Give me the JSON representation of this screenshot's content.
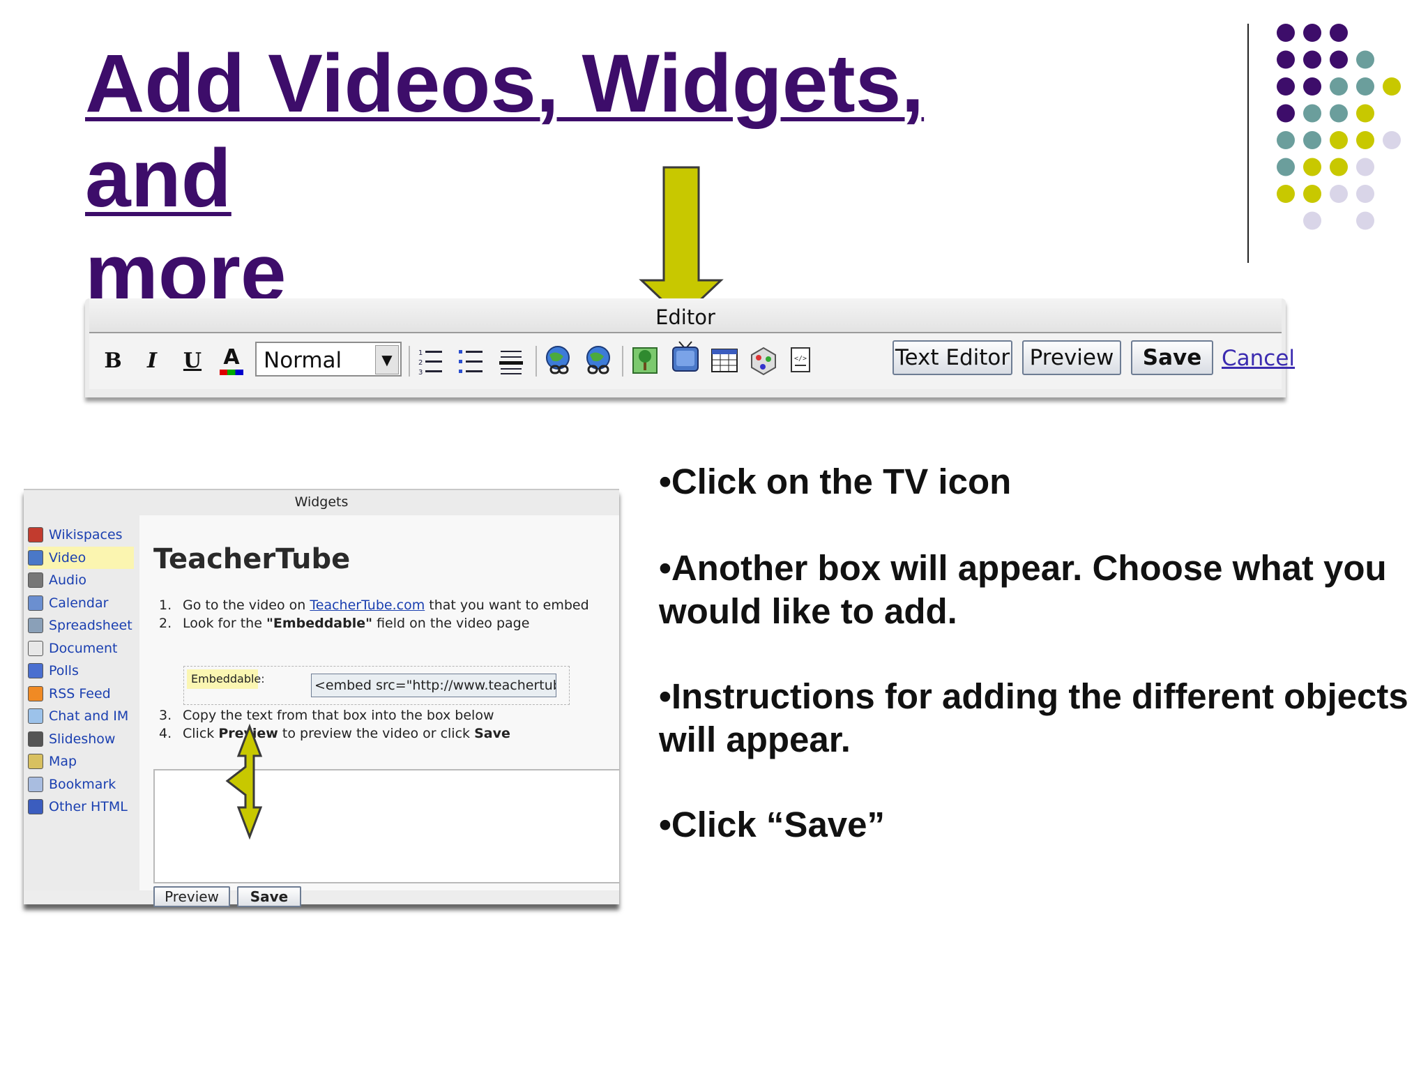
{
  "slide": {
    "title_line1": "Add Videos, Widgets, and",
    "title_line2": "more"
  },
  "colors": {
    "title": "#3d0d6a",
    "accent_yellow": "#c8c800",
    "dot_purple": "#3d0d6a",
    "dot_teal": "#6b9e9c",
    "dot_yellow": "#c8c800",
    "dot_lavender": "#d9d5e8"
  },
  "editor": {
    "title": "Editor",
    "bold_label": "B",
    "italic_label": "I",
    "underline_label": "U",
    "text_color_label": "A",
    "style_value": "Normal",
    "text_editor_button": "Text Editor",
    "preview_button": "Preview",
    "save_button": "Save",
    "cancel_link": "Cancel",
    "icons": [
      "numbered-list-icon",
      "bullet-list-icon",
      "horizontal-rule-icon",
      "link-icon",
      "external-link-icon",
      "image-icon",
      "tv-icon",
      "table-icon",
      "special-char-icon",
      "page-icon"
    ]
  },
  "widgets": {
    "title": "Widgets",
    "items": [
      {
        "label": "Wikispaces",
        "icon": "wikispaces-icon",
        "selected": false
      },
      {
        "label": "Video",
        "icon": "tv-icon",
        "selected": true
      },
      {
        "label": "Audio",
        "icon": "speaker-icon",
        "selected": false
      },
      {
        "label": "Calendar",
        "icon": "calendar-icon",
        "selected": false
      },
      {
        "label": "Spreadsheet",
        "icon": "spreadsheet-icon",
        "selected": false
      },
      {
        "label": "Document",
        "icon": "document-icon",
        "selected": false
      },
      {
        "label": "Polls",
        "icon": "poll-chart-icon",
        "selected": false
      },
      {
        "label": "RSS Feed",
        "icon": "rss-icon",
        "selected": false
      },
      {
        "label": "Chat and IM",
        "icon": "chat-icon",
        "selected": false
      },
      {
        "label": "Slideshow",
        "icon": "camera-icon",
        "selected": false
      },
      {
        "label": "Map",
        "icon": "map-icon",
        "selected": false
      },
      {
        "label": "Bookmark",
        "icon": "bookmark-tag-icon",
        "selected": false
      },
      {
        "label": "Other HTML",
        "icon": "html-icon",
        "selected": false
      }
    ],
    "main_title": "TeacherTube",
    "step1_num": "1.",
    "step1_pre": "Go to the video on ",
    "step1_link": "TeacherTube.com",
    "step1_post": " that you want to embed",
    "step2_num": "2.",
    "step2_pre": "Look for the ",
    "step2_bold": "\"Embeddable\"",
    "step2_post": " field on the video page",
    "embed_label": "Embeddable:",
    "embed_value": "<embed src=\"http://www.teachertube",
    "step3_num": "3.",
    "step3_text": "Copy the text from that box into the box below",
    "step4_num": "4.",
    "step4_pre": "Click ",
    "step4_bold1": "Preview",
    "step4_mid": " to preview the video or click ",
    "step4_bold2": "Save",
    "preview_button": "Preview",
    "save_button": "Save"
  },
  "bullets": {
    "b1": "•Click on the TV icon",
    "b2": "•Another box will appear. Choose what you would like to add.",
    "b3": "•Instructions for adding the different objects will appear.",
    "b4": "•Click “Save”"
  }
}
